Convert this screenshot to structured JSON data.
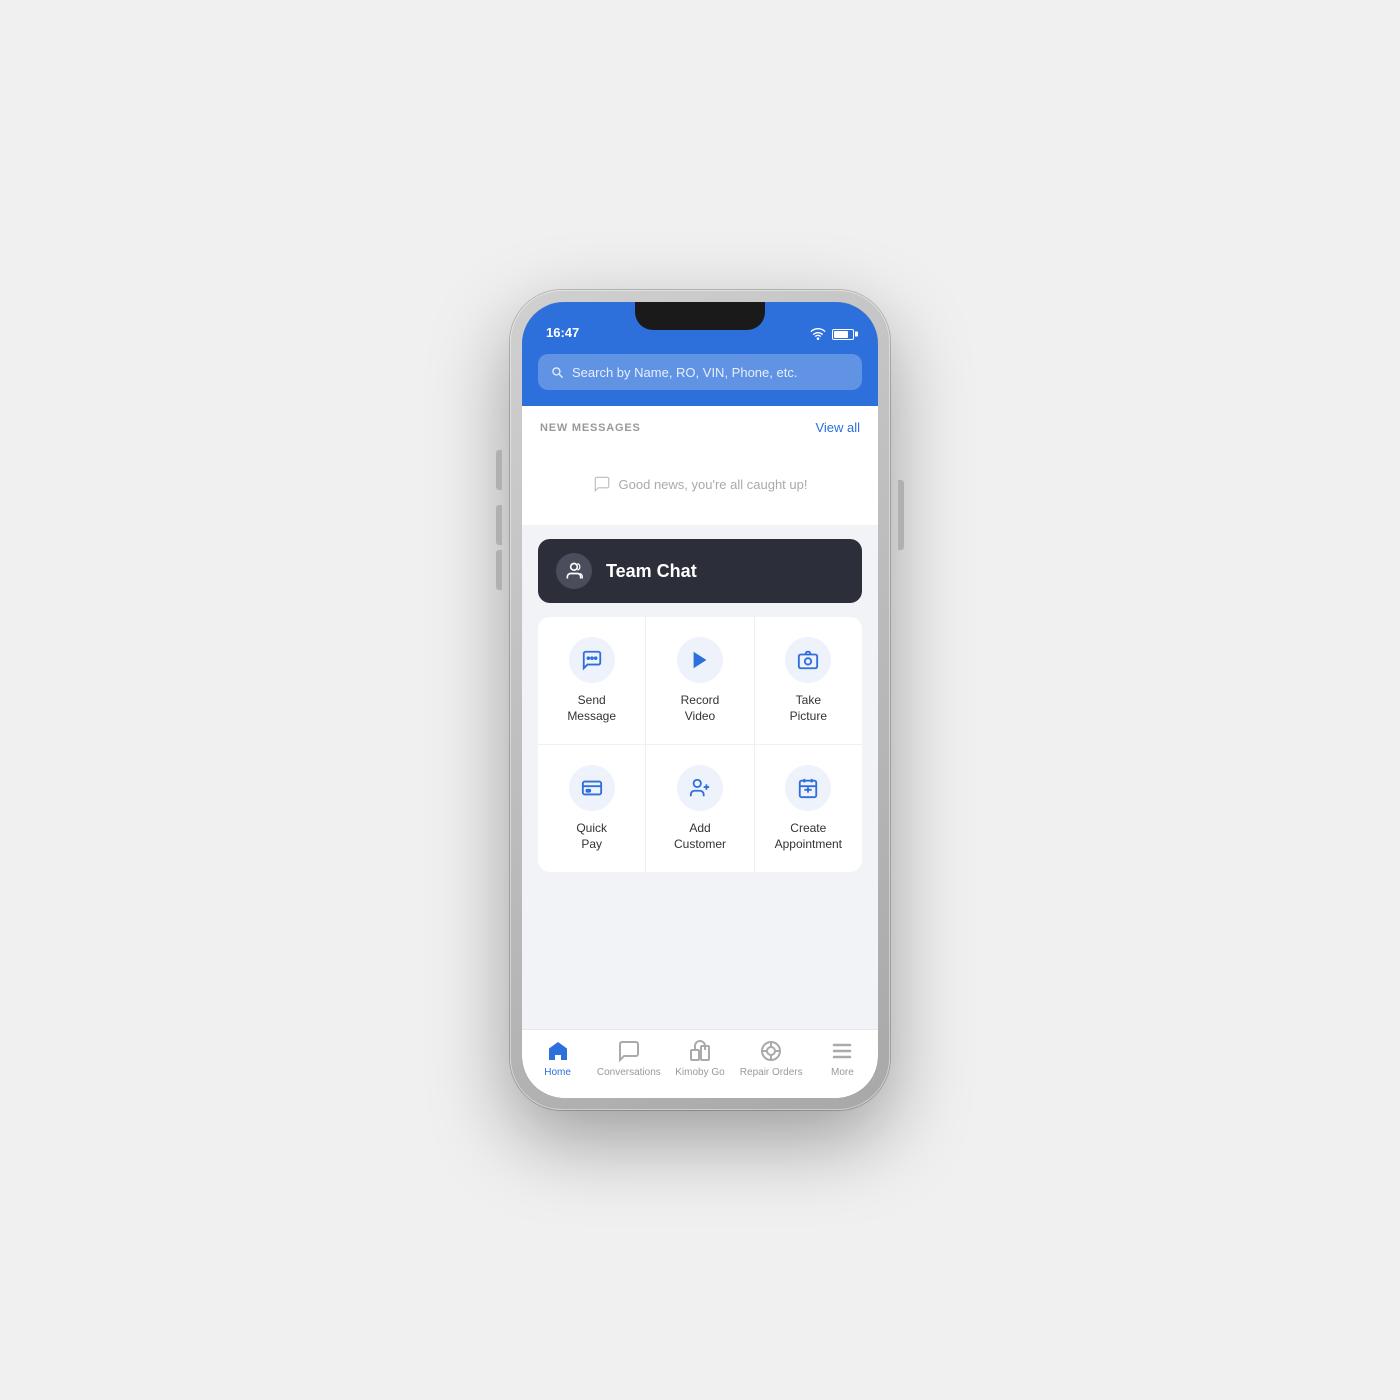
{
  "status": {
    "time": "16:47",
    "wifi": true,
    "battery": 80
  },
  "search": {
    "placeholder": "Search by Name, RO, VIN, Phone, etc."
  },
  "messages": {
    "section_label": "NEW MESSAGES",
    "view_all": "View all",
    "empty_message": "Good news, you're all caught up!"
  },
  "team_chat": {
    "label": "Team Chat"
  },
  "actions": {
    "row1": [
      {
        "id": "send-message",
        "label": "Send\nMessage",
        "icon": "chat"
      },
      {
        "id": "record-video",
        "label": "Record\nVideo",
        "icon": "play"
      },
      {
        "id": "take-picture",
        "label": "Take\nPicture",
        "icon": "camera"
      }
    ],
    "row2": [
      {
        "id": "quick-pay",
        "label": "Quick\nPay",
        "icon": "payment"
      },
      {
        "id": "add-customer",
        "label": "Add\nCustomer",
        "icon": "person-add"
      },
      {
        "id": "create-appointment",
        "label": "Create\nAppointment",
        "icon": "calendar"
      }
    ]
  },
  "nav": {
    "items": [
      {
        "id": "home",
        "label": "Home",
        "active": true
      },
      {
        "id": "conversations",
        "label": "Conversations",
        "active": false
      },
      {
        "id": "kimoby-go",
        "label": "Kimoby Go",
        "active": false
      },
      {
        "id": "repair-orders",
        "label": "Repair Orders",
        "active": false
      },
      {
        "id": "more",
        "label": "More",
        "active": false
      }
    ]
  }
}
